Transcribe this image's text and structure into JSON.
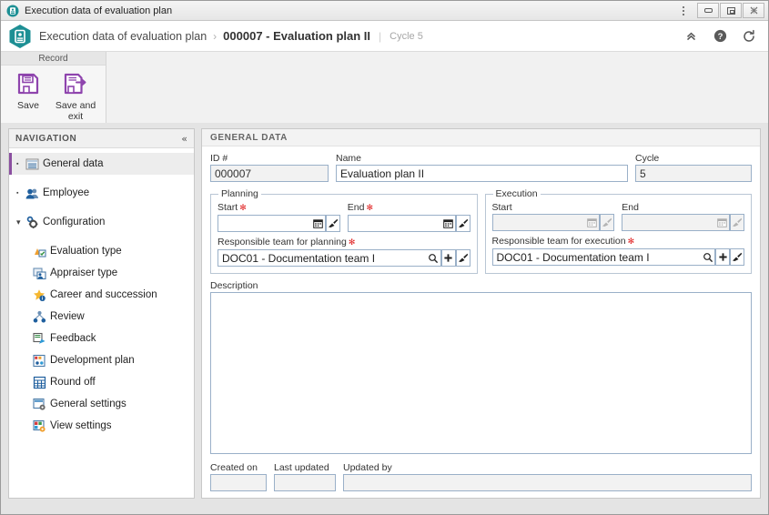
{
  "window": {
    "title": "Execution data of evaluation plan",
    "app_icon": "id-badge-icon",
    "menu_icon": "kebab-menu-icon",
    "minimize_label": "–",
    "maximize_label": "□",
    "close_label": "✕"
  },
  "breadcrumb": {
    "root": "Execution data of evaluation plan",
    "separator": "›",
    "current": "000007 - Evaluation plan II",
    "divider": "|",
    "cycle": "Cycle 5",
    "actions": [
      {
        "name": "collapse-up-icon",
        "glyph": "«"
      },
      {
        "name": "help-icon",
        "glyph": "?"
      },
      {
        "name": "refresh-icon",
        "glyph": "↻"
      }
    ]
  },
  "ribbon": {
    "group_title": "Record",
    "buttons": [
      {
        "label": "Save",
        "icon": "save-floppy-icon"
      },
      {
        "label": "Save and exit",
        "icon": "save-and-exit-floppy-icon"
      }
    ]
  },
  "navigation": {
    "header": "NAVIGATION",
    "collapse_glyph": "«",
    "items": [
      {
        "label": "General data",
        "level": 0,
        "bullet": "▪",
        "selected": true,
        "icon": "window-list-icon"
      },
      {
        "label": "Employee",
        "level": 0,
        "bullet": "▪",
        "selected": false,
        "icon": "employee-users-icon"
      },
      {
        "label": "Configuration",
        "level": 0,
        "bullet": "▾",
        "selected": false,
        "icon": "gear-config-icon"
      },
      {
        "label": "Evaluation type",
        "level": 1,
        "bullet": "",
        "selected": false,
        "icon": "evaluation-type-icon"
      },
      {
        "label": "Appraiser type",
        "level": 1,
        "bullet": "",
        "selected": false,
        "icon": "appraiser-type-icon"
      },
      {
        "label": "Career and succession",
        "level": 1,
        "bullet": "",
        "selected": false,
        "icon": "career-star-icon"
      },
      {
        "label": "Review",
        "level": 1,
        "bullet": "",
        "selected": false,
        "icon": "review-network-icon"
      },
      {
        "label": "Feedback",
        "level": 1,
        "bullet": "",
        "selected": false,
        "icon": "feedback-icon"
      },
      {
        "label": "Development plan",
        "level": 1,
        "bullet": "",
        "selected": false,
        "icon": "development-plan-icon"
      },
      {
        "label": "Round off",
        "level": 1,
        "bullet": "",
        "selected": false,
        "icon": "round-off-grid-icon"
      },
      {
        "label": "General settings",
        "level": 1,
        "bullet": "",
        "selected": false,
        "icon": "general-settings-icon"
      },
      {
        "label": "View settings",
        "level": 1,
        "bullet": "",
        "selected": false,
        "icon": "view-settings-icon"
      }
    ]
  },
  "general_data": {
    "section_title": "GENERAL DATA",
    "id": {
      "label": "ID #",
      "value": "000007",
      "readonly": true
    },
    "name": {
      "label": "Name",
      "value": "Evaluation plan II",
      "readonly": false
    },
    "cycle": {
      "label": "Cycle",
      "value": "5",
      "readonly": true
    },
    "planning": {
      "legend": "Planning",
      "start": {
        "label": "Start",
        "value": "",
        "required": true,
        "disabled": false
      },
      "end": {
        "label": "End",
        "value": "",
        "required": true,
        "disabled": false
      },
      "team": {
        "label": "Responsible team for planning",
        "value": "DOC01 - Documentation team I",
        "required": true
      }
    },
    "execution": {
      "legend": "Execution",
      "start": {
        "label": "Start",
        "value": "",
        "required": false,
        "disabled": true
      },
      "end": {
        "label": "End",
        "value": "",
        "required": false,
        "disabled": true
      },
      "team": {
        "label": "Responsible team for execution",
        "value": "DOC01 - Documentation team I",
        "required": true
      }
    },
    "description": {
      "label": "Description",
      "value": ""
    },
    "created_on": {
      "label": "Created on",
      "value": ""
    },
    "last_updated": {
      "label": "Last updated",
      "value": ""
    },
    "updated_by": {
      "label": "Updated by",
      "value": ""
    },
    "field_icons": {
      "calendar": "calendar-icon",
      "clear": "eraser-clear-icon",
      "lookup": "magnifier-lookup-icon",
      "add": "plus-add-icon",
      "required_marker": "✻"
    }
  }
}
